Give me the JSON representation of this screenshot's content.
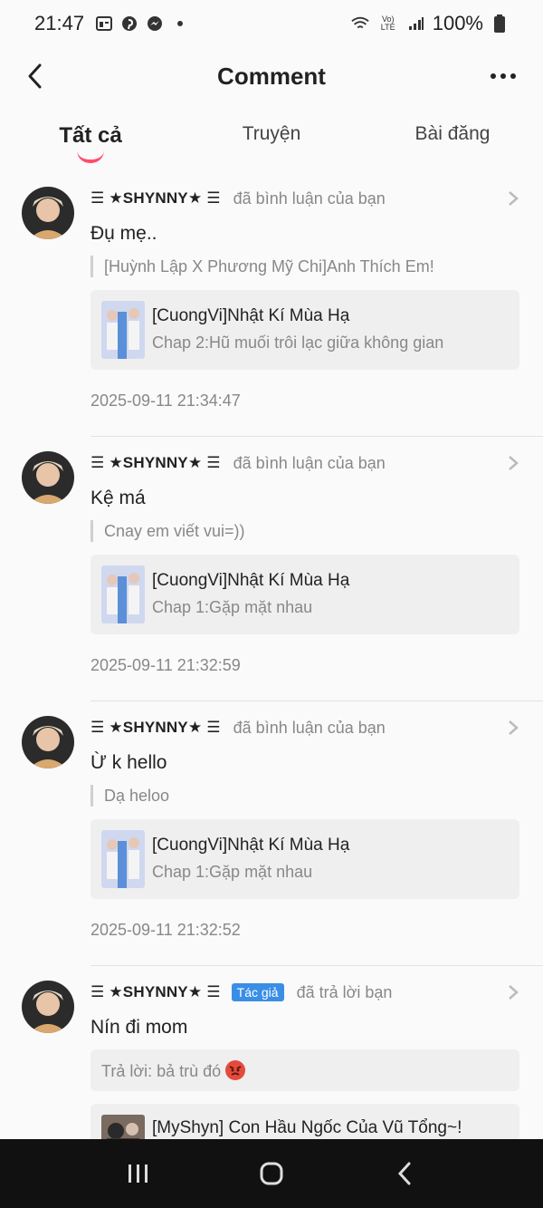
{
  "status": {
    "time": "21:47",
    "battery": "100%",
    "network": "Vo) LTE"
  },
  "nav": {
    "title": "Comment"
  },
  "tabs": [
    {
      "label": "Tất cả",
      "active": true
    },
    {
      "label": "Truyện",
      "active": false
    },
    {
      "label": "Bài đăng",
      "active": false
    }
  ],
  "items": [
    {
      "username": "☰ ★SHYNNY★ ☰",
      "action": "đã bình luận của bạn",
      "comment": "Đụ mẹ..",
      "quote": "[Huỳnh Lập X Phương Mỹ Chi]Anh Thích Em!",
      "card_title": "[CuongVi]Nhật Kí Mùa Hạ",
      "card_sub": "Chap 2:Hũ muối trôi lạc giữa không gian",
      "time": "2025-09-11 21:34:47"
    },
    {
      "username": "☰ ★SHYNNY★ ☰",
      "action": "đã bình luận của bạn",
      "comment": "Kệ má",
      "quote": "Cnay em viết vui=))",
      "card_title": "[CuongVi]Nhật Kí Mùa Hạ",
      "card_sub": "Chap 1:Gặp mặt nhau",
      "time": "2025-09-11 21:32:59"
    },
    {
      "username": "☰ ★SHYNNY★ ☰",
      "action": "đã bình luận của bạn",
      "comment": "Ừ k hello",
      "quote": "Dạ heloo",
      "card_title": "[CuongVi]Nhật Kí Mùa Hạ",
      "card_sub": "Chap 1:Gặp mặt nhau",
      "time": "2025-09-11 21:32:52"
    },
    {
      "username": "☰ ★SHYNNY★ ☰",
      "badge": "Tác giả",
      "action": "đã trả lời bạn",
      "comment": "Nín đi mom",
      "reply": "Trả lời: bả trù đó",
      "card_title": "[MyShyn] Con Hầu Ngốc Của Vũ Tổng~!"
    }
  ],
  "colors": {
    "accent": "#ff4d6d",
    "badge": "#3a8ee6"
  }
}
